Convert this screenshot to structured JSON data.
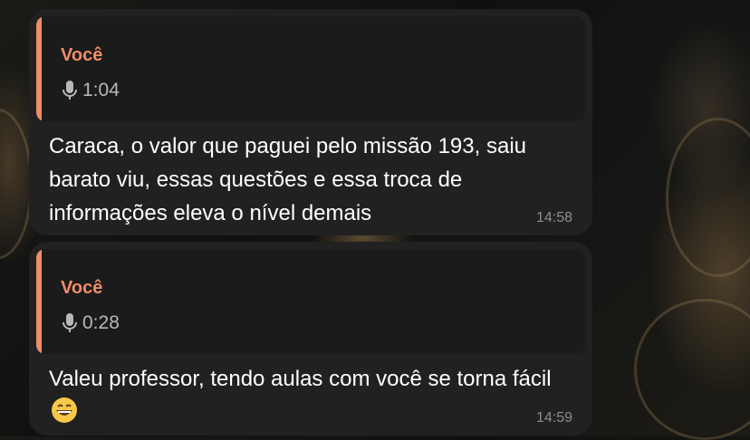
{
  "messages": [
    {
      "reply": {
        "author": "Você",
        "icon": "microphone-icon",
        "duration": "1:04"
      },
      "text": "Caraca, o valor que paguei pelo missão 193, saiu barato viu, essas questões e essa troca de informações eleva o nível demais",
      "time": "14:58"
    },
    {
      "reply": {
        "author": "Você",
        "icon": "microphone-icon",
        "duration": "0:28"
      },
      "text": "Valeu professor, tendo aulas com você se torna fácil",
      "emoji": "grinning-face-emoji",
      "time": "14:59"
    }
  ],
  "colors": {
    "accent": "#f08c66",
    "bubble": "#212121",
    "reply_bg": "#1b1b1b"
  }
}
